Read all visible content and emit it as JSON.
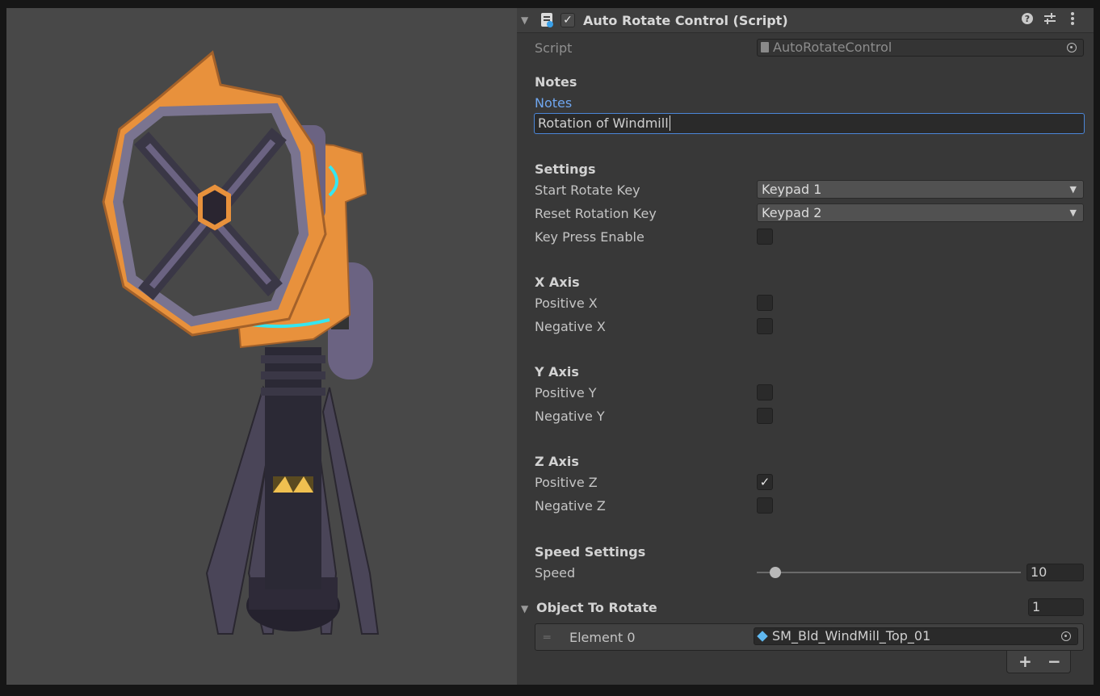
{
  "component": {
    "title": "Auto Rotate Control (Script)",
    "enabled": true,
    "header_icons": [
      "help-icon",
      "preset-icon",
      "kebab-menu-icon"
    ]
  },
  "script_row": {
    "label": "Script",
    "value": "AutoRotateControl"
  },
  "notes": {
    "header": "Notes",
    "label": "Notes",
    "value": "Rotation of Windmill"
  },
  "settings": {
    "header": "Settings",
    "start_key_label": "Start Rotate Key",
    "start_key_value": "Keypad 1",
    "reset_key_label": "Reset Rotation Key",
    "reset_key_value": "Keypad 2",
    "key_press_label": "Key Press Enable",
    "key_press_checked": false
  },
  "x_axis": {
    "header": "X Axis",
    "pos_label": "Positive X",
    "pos_checked": false,
    "neg_label": "Negative X",
    "neg_checked": false
  },
  "y_axis": {
    "header": "Y Axis",
    "pos_label": "Positive Y",
    "pos_checked": false,
    "neg_label": "Negative Y",
    "neg_checked": false
  },
  "z_axis": {
    "header": "Z Axis",
    "pos_label": "Positive Z",
    "pos_checked": true,
    "neg_label": "Negative Z",
    "neg_checked": false
  },
  "speed": {
    "header": "Speed Settings",
    "label": "Speed",
    "value": "10",
    "slider_fraction": 0.07
  },
  "object_list": {
    "header": "Object To Rotate",
    "count": "1",
    "element_label": "Element 0",
    "element_value": "SM_Bld_WindMill_Top_01",
    "add_label": "+",
    "remove_label": "−"
  },
  "colors": {
    "orange": "#e8913c",
    "purple": "#6b6382",
    "cyan": "#35e6f0",
    "link": "#6fa6ef"
  }
}
